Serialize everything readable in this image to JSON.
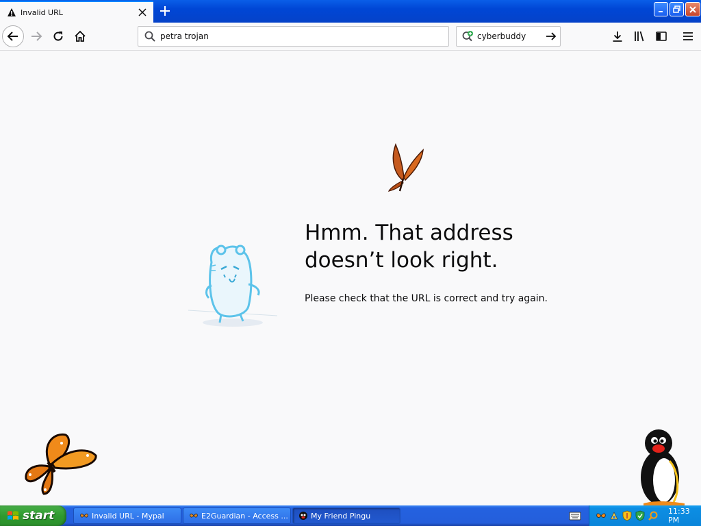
{
  "tab": {
    "title": "Invalid URL"
  },
  "navbar": {
    "url_value": "petra trojan",
    "search_value": "cyberbuddy"
  },
  "error_page": {
    "heading_line1": "Hmm. That address",
    "heading_line2": "doesn’t look right.",
    "description": "Please check that the URL is correct and try again."
  },
  "taskbar": {
    "start_label": "start",
    "tasks": [
      {
        "label": "Invalid URL - Mypal"
      },
      {
        "label": "E2Guardian - Access ..."
      },
      {
        "label": "My Friend Pingu"
      }
    ],
    "clock": "11:33 PM"
  },
  "colors": {
    "title_bar": "#0046d5",
    "start_button": "#2f9a2f",
    "taskbar": "#245edb",
    "tray": "#0a85da",
    "error_text": "#0c0c0d"
  },
  "icons": [
    "warning-icon",
    "close-icon",
    "plus-icon",
    "back-icon",
    "forward-icon",
    "reload-icon",
    "home-icon",
    "search-icon",
    "search-engine-icon",
    "go-arrow-icon",
    "download-icon",
    "library-icon",
    "sidebar-icon",
    "menu-icon",
    "windows-flag-icon",
    "keyboard-icon",
    "butterfly-icon",
    "penguin-icon"
  ]
}
